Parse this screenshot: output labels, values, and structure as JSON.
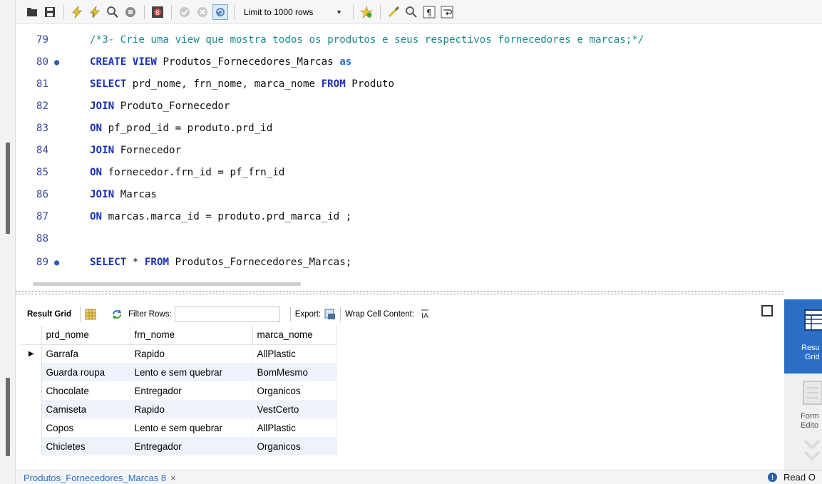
{
  "toolbar": {
    "limit_label": "Limit to 1000 rows"
  },
  "editor": {
    "lines": [
      {
        "num": "79",
        "marker": ""
      },
      {
        "num": "80",
        "marker": "●"
      },
      {
        "num": "81",
        "marker": ""
      },
      {
        "num": "82",
        "marker": ""
      },
      {
        "num": "83",
        "marker": ""
      },
      {
        "num": "84",
        "marker": ""
      },
      {
        "num": "85",
        "marker": ""
      },
      {
        "num": "86",
        "marker": ""
      },
      {
        "num": "87",
        "marker": ""
      },
      {
        "num": "88",
        "marker": ""
      },
      {
        "num": "89",
        "marker": "●"
      }
    ],
    "code": {
      "l79": "/*3- Crie uma view que mostra todos os produtos e seus respectivos fornecedores e marcas;*/",
      "l80_kw": "CREATE VIEW",
      "l80_name": " Produtos_Fornecedores_Marcas ",
      "l80_as": "as",
      "l81_kw1": "SELECT",
      "l81_cols": " prd_nome, frn_nome, marca_nome ",
      "l81_kw2": "FROM",
      "l81_tbl": " Produto",
      "l82_kw": "JOIN",
      "l82_tbl": " Produto_Fornecedor",
      "l83_kw": "ON",
      "l83_cond": " pf_prod_id = produto.prd_id",
      "l84_kw": "JOIN",
      "l84_tbl": " Fornecedor",
      "l85_kw": "ON",
      "l85_cond": " fornecedor.frn_id = pf_frn_id",
      "l86_kw": "JOIN",
      "l86_tbl": " Marcas",
      "l87_kw": "ON",
      "l87_cond": " marcas.marca_id = produto.prd_marca_id ;",
      "l89_kw1": "SELECT",
      "l89_star": " * ",
      "l89_kw2": "FROM",
      "l89_tbl": " Produtos_Fornecedores_Marcas;"
    }
  },
  "results": {
    "grid_label": "Result Grid",
    "filter_label": "Filter Rows:",
    "filter_value": "",
    "export_label": "Export:",
    "wrap_label": "Wrap Cell Content:",
    "columns": [
      "prd_nome",
      "frn_nome",
      "marca_nome"
    ],
    "rows": [
      [
        "Garrafa",
        "Rapido",
        "AllPlastic"
      ],
      [
        "Guarda roupa",
        "Lento e sem quebrar",
        "BomMesmo"
      ],
      [
        "Chocolate",
        "Entregador",
        "Organicos"
      ],
      [
        "Camiseta",
        "Rapido",
        "VestCerto"
      ],
      [
        "Copos",
        "Lento e sem quebrar",
        "AllPlastic"
      ],
      [
        "Chicletes",
        "Entregador",
        "Organicos"
      ]
    ]
  },
  "side_panel": {
    "active_label_1": "Resu",
    "active_label_2": "Grid",
    "other_label_1": "Form",
    "other_label_2": "Edito"
  },
  "bottom": {
    "tab_label": "Produtos_Fornecedores_Marcas 8",
    "close_glyph": "×",
    "status": "Read O"
  },
  "colors": {
    "keyword": "#1a2fb3",
    "comment": "#1d8a8f",
    "accent": "#2a6fc5"
  }
}
